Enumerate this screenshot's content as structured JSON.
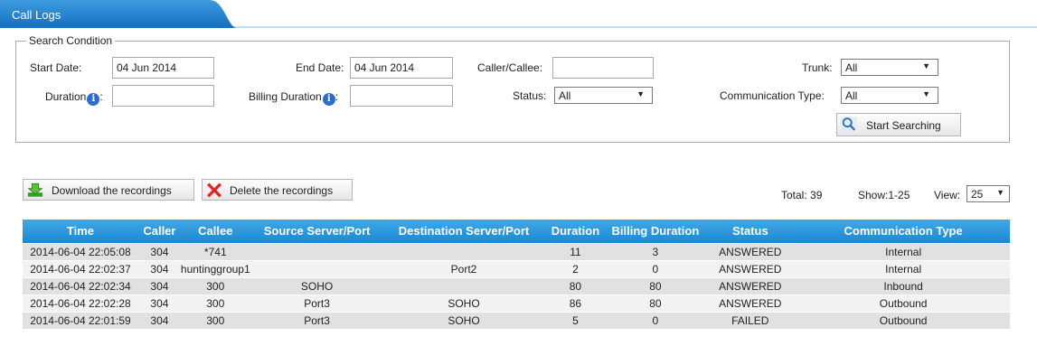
{
  "tab": {
    "title": "Call Logs"
  },
  "search": {
    "legend": "Search Condition",
    "start_date_label": "Start Date:",
    "start_date_value": "04 Jun 2014",
    "end_date_label": "End Date:",
    "end_date_value": "04 Jun 2014",
    "caller_callee_label": "Caller/Callee:",
    "caller_callee_value": "",
    "trunk_label": "Trunk:",
    "trunk_value": "All",
    "duration_label": "Duration",
    "duration_value": "",
    "billing_duration_label": "Billing Duration",
    "billing_duration_value": "",
    "status_label": "Status:",
    "status_value": "All",
    "comm_type_label": "Communication Type:",
    "comm_type_value": "All",
    "colon": ":",
    "start_button": "Start Searching"
  },
  "actions": {
    "download_label": "Download the recordings",
    "delete_label": "Delete the recordings"
  },
  "summary": {
    "total": "Total: 39",
    "show": "Show:1-25",
    "view_label": "View:",
    "view_value": "25"
  },
  "table": {
    "columns": [
      "Time",
      "Caller",
      "Callee",
      "Source Server/Port",
      "Destination Server/Port",
      "Duration",
      "Billing Duration",
      "Status",
      "Communication Type"
    ],
    "rows": [
      [
        "2014-06-04 22:05:08",
        "304",
        "*741",
        "",
        "",
        "11",
        "3",
        "ANSWERED",
        "Internal"
      ],
      [
        "2014-06-04 22:02:37",
        "304",
        "huntinggroup1",
        "",
        "Port2",
        "2",
        "0",
        "ANSWERED",
        "Internal"
      ],
      [
        "2014-06-04 22:02:34",
        "304",
        "300",
        "SOHO",
        "",
        "80",
        "80",
        "ANSWERED",
        "Inbound"
      ],
      [
        "2014-06-04 22:02:28",
        "304",
        "300",
        "Port3",
        "SOHO",
        "86",
        "80",
        "ANSWERED",
        "Outbound"
      ],
      [
        "2014-06-04 22:01:59",
        "304",
        "300",
        "Port3",
        "SOHO",
        "5",
        "0",
        "FAILED",
        "Outbound"
      ]
    ]
  },
  "colors": {
    "tab": "#1a7fcd",
    "header": "#1b88d3",
    "row_odd": "#e1e1e1",
    "row_even": "#f2f2f2"
  },
  "icons": {
    "download": "download-arrow-icon",
    "delete": "red-x-icon",
    "search": "magnifier-icon",
    "info": "info-icon"
  }
}
